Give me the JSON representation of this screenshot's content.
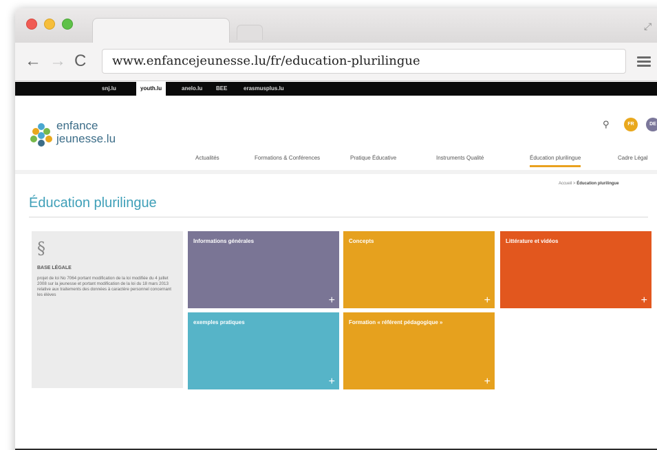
{
  "browser": {
    "url": "www.enfancejeunesse.lu/fr/education-plurilingue"
  },
  "topbar": {
    "items": [
      "snj.lu",
      "youth.lu",
      "anelo.lu",
      "BEE",
      "erasmusplus.lu"
    ],
    "active_index": 1
  },
  "brand": {
    "name_line1": "enfance",
    "name_line2a": "jeunesse",
    "name_line2b": ".lu"
  },
  "languages": [
    "FR",
    "DE"
  ],
  "mainnav": {
    "items": [
      "Actualités",
      "Formations & Conférences",
      "Pratique Éducative",
      "Instruments Qualité",
      "Éducation plurilingue",
      "Cadre Légal"
    ],
    "active_index": 4
  },
  "breadcrumb": {
    "home": "Accueil",
    "separator": ">",
    "current": "Éducation plurilingue"
  },
  "page": {
    "title": "Éducation plurilingue"
  },
  "legal": {
    "symbol": "§",
    "title": "BASE LÉGALE",
    "text": "projet de loi No 7064 portant modification de la loi modifiée du 4 juillet 2008 sur la jeunesse et portant modification de la loi du 18 mars 2013 relative aux traitements des données à caractère personnel concernant les élèves"
  },
  "tiles": [
    {
      "label": "Informations générales",
      "color": "#7a7595"
    },
    {
      "label": "Concepts",
      "color": "#e6a11e"
    },
    {
      "label": "Littérature et vidéos",
      "color": "#e2571e"
    },
    {
      "label": "exemples pratiques",
      "color": "#56b4c8"
    },
    {
      "label": "Formation « référent pédagogique »",
      "color": "#e6a11e"
    }
  ],
  "tile_plus": "+"
}
